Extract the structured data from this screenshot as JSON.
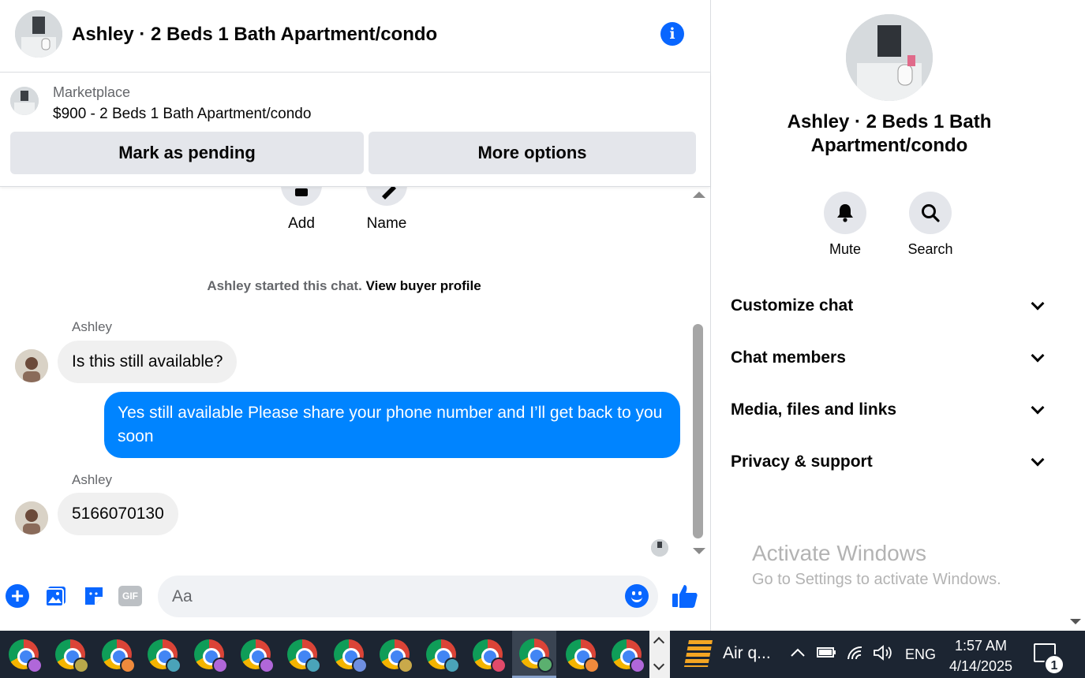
{
  "chat": {
    "title": "Ashley · 2 Beds 1 Bath Apartment/condo",
    "marketplace": {
      "label": "Marketplace",
      "listing": "$900 - 2 Beds 1 Bath Apartment/condo",
      "pending_button": "Mark as pending",
      "more_button": "More options"
    },
    "quick_actions": [
      "Add",
      "Name"
    ],
    "start_text": "Ashley started this chat.",
    "start_link": "View buyer profile",
    "messages": [
      {
        "sender": "Ashley",
        "text": "Is this still available?",
        "direction": "incoming"
      },
      {
        "text": "Yes still available Please share your phone number and I’ll get back to you soon",
        "direction": "outgoing"
      },
      {
        "sender": "Ashley",
        "text": "5166070130",
        "direction": "incoming"
      }
    ],
    "composer": {
      "placeholder": "Aa",
      "gif_label": "GIF"
    }
  },
  "details": {
    "title": "Ashley · 2 Beds 1 Bath Apartment/condo",
    "actions": [
      "Mute",
      "Search"
    ],
    "sections": [
      "Customize chat",
      "Chat members",
      "Media, files and links",
      "Privacy & support"
    ]
  },
  "watermark": {
    "title": "Activate Windows",
    "subtitle": "Go to Settings to activate Windows."
  },
  "taskbar": {
    "chrome_profile_colors": [
      "#b067d9",
      "#b9a84a",
      "#f08a3c",
      "#4aa3b9",
      "#b067d9",
      "#b067d9",
      "#4aa3b9",
      "#6f8fe0",
      "#c9a94a",
      "#4aa3b9",
      "#e04a6a",
      "#5bb06f",
      "#f08a3c",
      "#b067d9"
    ],
    "active_index": 11,
    "weather_label": "Air q...",
    "language": "ENG",
    "time": "1:57 AM",
    "date": "4/14/2025",
    "notification_count": "1"
  },
  "colors": {
    "accent": "#0866ff",
    "outgoing_bubble": "#0084ff",
    "incoming_bubble": "#f0f0f0"
  }
}
